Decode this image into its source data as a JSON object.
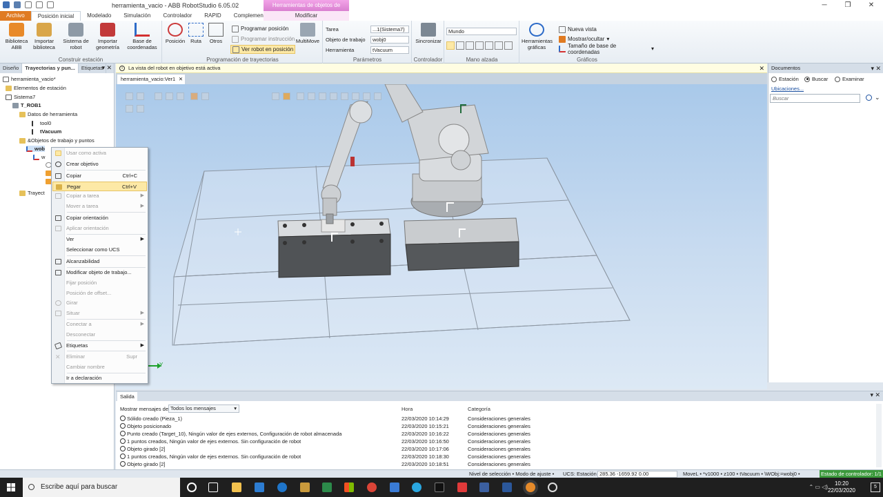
{
  "window": {
    "title": "herramienta_vacio - ABB RobotStudio 6.05.02",
    "context_tab": "Herramientas de objetos de trabajo"
  },
  "ribbon_tabs": [
    "Archivo",
    "Posición inicial",
    "Modelado",
    "Simulación",
    "Controlador",
    "RAPID",
    "Complementos"
  ],
  "context_subtab": "Modificar",
  "ribbon": {
    "construir_estacion": {
      "label": "Construir estación",
      "buttons": [
        "Biblioteca ABB",
        "Importar biblioteca",
        "Sistema de robot",
        "Importar geometría",
        "Base de coordenadas"
      ]
    },
    "programacion": {
      "label": "Programación de trayectorias",
      "buttons": [
        "Posición",
        "Ruta",
        "Otros"
      ],
      "small": [
        "Programar posición",
        "Programar instrucción",
        "Ver robot en posición"
      ],
      "multimove": "MultiMove"
    },
    "parametros": {
      "label": "Parámetros",
      "tarea_label": "Tarea",
      "tarea_value": "...1(Sistema7)",
      "objeto_label": "Objeto de trabajo",
      "objeto_value": "wobj0",
      "herramienta_label": "Herramienta",
      "herramienta_value": "tVacuum"
    },
    "controlador": {
      "label": "Controlador",
      "button": "Sincronizar"
    },
    "mano_alzada": {
      "label": "Mano alzada",
      "frame_value": "Mundo"
    },
    "graficos": {
      "label": "Gráficos",
      "button": "Herramientas gráficas",
      "small": [
        "Nueva vista",
        "Mostrar/ocultar",
        "Tamaño de base de coordenadas"
      ]
    }
  },
  "left_panel": {
    "tabs": [
      "Diseño",
      "Trayectorias y pun...",
      "Etiquetas"
    ],
    "tree": {
      "root": "herramienta_vacio*",
      "elementos": "Elementos de estación",
      "sistema": "Sistema7",
      "rob": "T_ROB1",
      "datos": "Datos de herramienta",
      "tool0": "tool0",
      "tvacuum": "tVacuum",
      "objetos": "&Objetos de trabajo y puntos",
      "wobj": "wob",
      "w": "w",
      "trayect": "Trayect"
    }
  },
  "info_bar": "La vista del robot en objetivo está activa",
  "doc_tab": "herramienta_vacio:Ver1",
  "context_menu": [
    {
      "label": "Usar como activa",
      "disabled": true
    },
    {
      "label": "Crear objetivo",
      "disabled": false
    },
    {
      "label": "Copiar",
      "shortcut": "Ctrl+C",
      "disabled": false
    },
    {
      "label": "Pegar",
      "shortcut": "Ctrl+V",
      "disabled": false,
      "hover": true
    },
    {
      "label": "Copiar a tarea",
      "disabled": true,
      "submenu": true
    },
    {
      "label": "Mover a tarea",
      "disabled": true,
      "submenu": true
    },
    {
      "label": "Copiar orientación",
      "disabled": false
    },
    {
      "label": "Aplicar orientación",
      "disabled": true
    },
    {
      "label": "Ver",
      "disabled": false,
      "submenu": true
    },
    {
      "label": "Seleccionar como UCS",
      "disabled": false
    },
    {
      "label": "Alcanzabilidad",
      "disabled": false
    },
    {
      "label": "Modificar objeto de trabajo...",
      "disabled": false
    },
    {
      "label": "Fijar posición",
      "disabled": true
    },
    {
      "label": "Posición de offset...",
      "disabled": true
    },
    {
      "label": "Girar",
      "disabled": true
    },
    {
      "label": "Situar",
      "disabled": true,
      "submenu": true
    },
    {
      "label": "Conectar a",
      "disabled": true,
      "submenu": true
    },
    {
      "label": "Desconectar",
      "disabled": true
    },
    {
      "label": "Etiquetas",
      "disabled": false,
      "submenu": true
    },
    {
      "label": "Eliminar",
      "shortcut": "Supr",
      "disabled": true
    },
    {
      "label": "Cambiar nombre",
      "disabled": true
    },
    {
      "label": "Ir a declaración",
      "disabled": false
    }
  ],
  "right_panel": {
    "title": "Documentos",
    "radios": [
      "Estación",
      "Buscar",
      "Examinar"
    ],
    "selected": "Buscar",
    "ubicaciones": "Ubicaciones...",
    "search_placeholder": "Buscar"
  },
  "output": {
    "tab": "Salida",
    "filter_label": "Mostrar mensajes de:",
    "filter_value": "Todos los mensajes",
    "col_hora": "Hora",
    "col_categoria": "Categoría",
    "rows": [
      {
        "msg": "Sólido creado (Pieza_1)",
        "hora": "22/03/2020 10:14:29",
        "cat": "Consideraciones generales"
      },
      {
        "msg": "Objeto posicionado",
        "hora": "22/03/2020 10:15:21",
        "cat": "Consideraciones generales"
      },
      {
        "msg": "Punto creado (Target_10), Ningún valor de ejes externos, Configuración de robot almacenada",
        "hora": "22/03/2020 10:16:22",
        "cat": "Consideraciones generales"
      },
      {
        "msg": "1 puntos creados, Ningún valor de ejes externos. Sin configuración de robot",
        "hora": "22/03/2020 10:16:50",
        "cat": "Consideraciones generales"
      },
      {
        "msg": "Objeto girado [2]",
        "hora": "22/03/2020 10:17:06",
        "cat": "Consideraciones generales"
      },
      {
        "msg": "1 puntos creados, Ningún valor de ejes externos. Sin configuración de robot",
        "hora": "22/03/2020 10:18:30",
        "cat": "Consideraciones generales"
      },
      {
        "msg": "Objeto girado [2]",
        "hora": "22/03/2020 10:18:51",
        "cat": "Consideraciones generales"
      }
    ]
  },
  "status_bar": {
    "nivel": "Nivel de selección •  Modo de ajuste •",
    "ucs": "UCS: Estación",
    "coords": "285.36  -1659.92  0.00",
    "movel": "MoveL •  *v1000 •  z100 •  tVacuum •  \\WObj:=wobj0 •",
    "controller": "Estado de controlador: 1/1"
  },
  "taskbar": {
    "search": "Escribe aquí para buscar",
    "time": "10:20",
    "date": "22/03/2020",
    "notifications": "5"
  },
  "viewport": {
    "axis_label": "Y"
  }
}
